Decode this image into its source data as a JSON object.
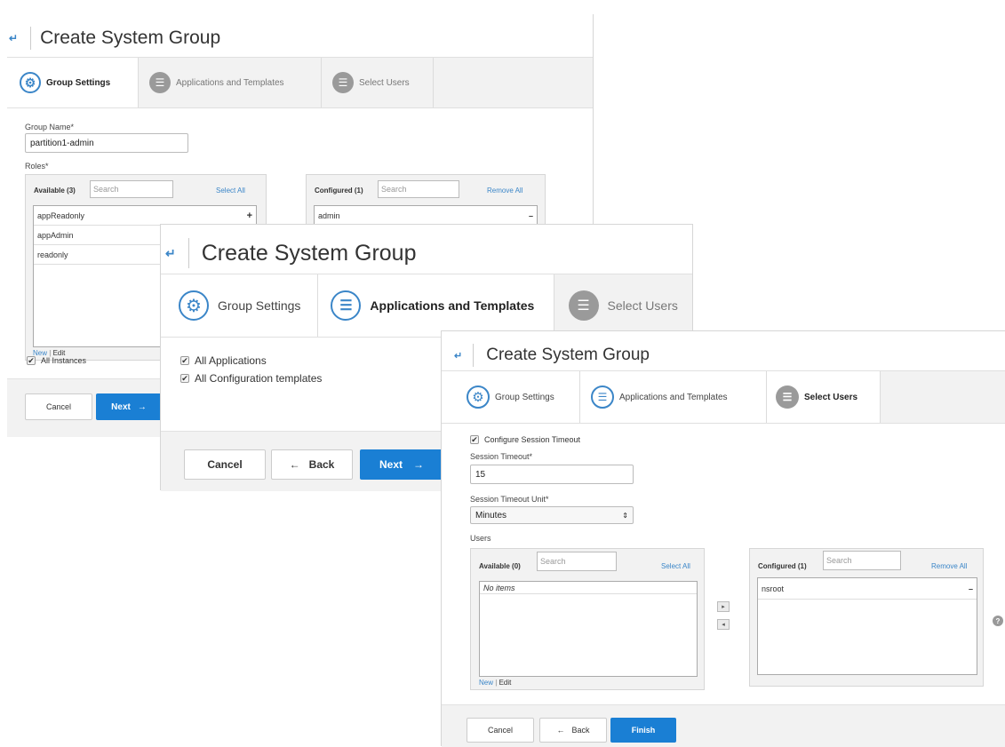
{
  "title": "Create System Group",
  "tabs": {
    "group_settings": "Group Settings",
    "apps_templates": "Applications and Templates",
    "select_users": "Select Users"
  },
  "panel1": {
    "group_name_label": "Group Name*",
    "group_name_value": "partition1-admin",
    "roles_label": "Roles*",
    "available_title": "Available (3)",
    "configured_title": "Configured (1)",
    "search_placeholder": "Search",
    "select_all": "Select All",
    "remove_all": "Remove All",
    "available_items": [
      "appReadonly",
      "appAdmin",
      "readonly"
    ],
    "configured_items": [
      "admin"
    ],
    "new_link": "New",
    "link_sep": "|",
    "edit_link": "Edit",
    "all_instances": "All Instances",
    "cancel": "Cancel",
    "next": "Next"
  },
  "panel2": {
    "all_applications": "All Applications",
    "all_config_templates": "All Configuration templates",
    "cancel": "Cancel",
    "back": "Back",
    "next": "Next"
  },
  "panel3": {
    "configure_session_timeout": "Configure Session Timeout",
    "session_timeout_label": "Session Timeout*",
    "session_timeout_value": "15",
    "timeout_unit_label": "Session Timeout Unit*",
    "timeout_unit_value": "Minutes",
    "users_label": "Users",
    "available_title": "Available (0)",
    "configured_title": "Configured (1)",
    "search_placeholder": "Search",
    "select_all": "Select All",
    "remove_all": "Remove All",
    "no_items": "No items",
    "configured_items": [
      "nsroot"
    ],
    "new_link": "New",
    "link_sep": "|",
    "edit_link": "Edit",
    "cancel": "Cancel",
    "back": "Back",
    "finish": "Finish"
  },
  "colors": {
    "accent": "#1a7fd4",
    "link": "#3b86c8"
  }
}
